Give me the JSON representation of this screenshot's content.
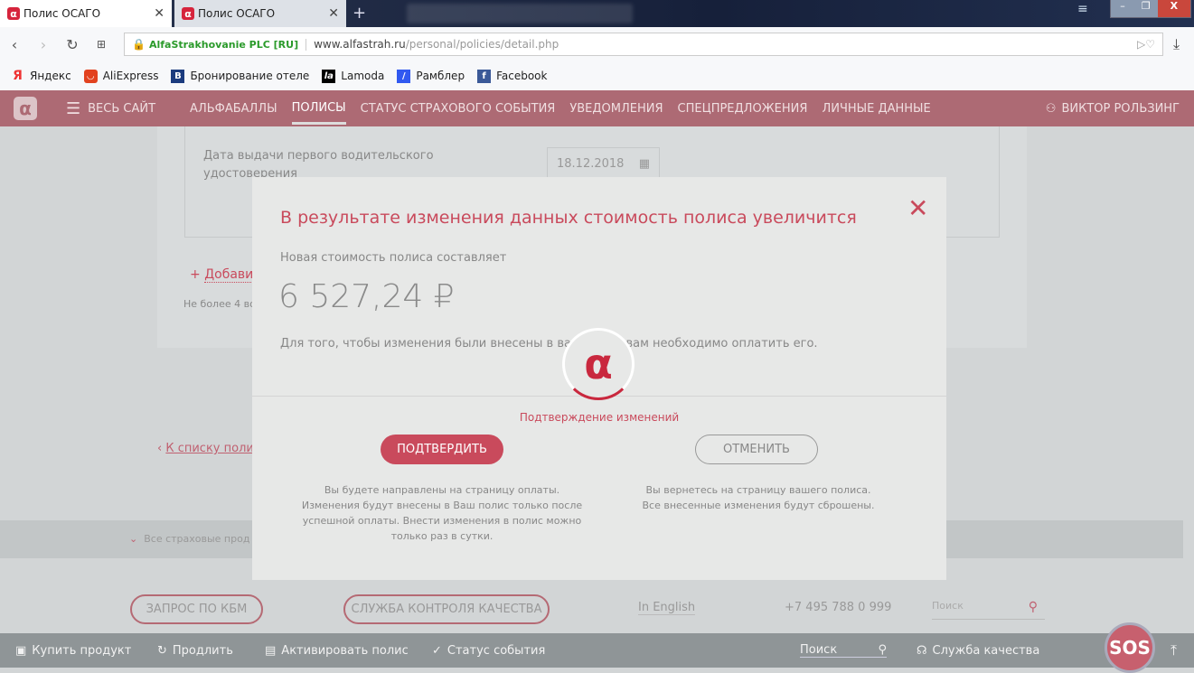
{
  "browser": {
    "tabs": [
      {
        "title": "Полис ОСАГО",
        "active": true
      },
      {
        "title": "Полис ОСАГО",
        "active": false
      }
    ],
    "address": {
      "security_label": "AlfaStrakhovanie PLC [RU]",
      "url_domain": "www.alfastrah.ru",
      "url_path": "/personal/policies/detail.php"
    },
    "bookmarks": [
      {
        "label": "Яндекс",
        "icon": "yandex-icon",
        "color": "#e33"
      },
      {
        "label": "AliExpress",
        "icon": "aliexpress-icon",
        "color": "#e2421f"
      },
      {
        "label": "Бронирование отеле",
        "icon": "booking-icon",
        "color": "#1b3b7e"
      },
      {
        "label": "Lamoda",
        "icon": "lamoda-icon",
        "color": "#000"
      },
      {
        "label": "Рамблер",
        "icon": "rambler-icon",
        "color": "#3159f0"
      },
      {
        "label": "Facebook",
        "icon": "facebook-icon",
        "color": "#3b5998"
      }
    ]
  },
  "site_nav": {
    "all_site": "ВЕСЬ САЙТ",
    "items": [
      "АЛЬФАБАЛЛЫ",
      "ПОЛИСЫ",
      "СТАТУС СТРАХОВОГО СОБЫТИЯ",
      "УВЕДОМЛЕНИЯ",
      "СПЕЦПРЕДЛОЖЕНИЯ",
      "ЛИЧНЫЕ ДАННЫЕ"
    ],
    "active": "ПОЛИСЫ",
    "user": "ВИКТОР РОЛЬЗИНГ",
    "brand_color": "#ad6a74"
  },
  "background_page": {
    "license_date_label": "Дата выдачи первого водительского удостоверения",
    "license_date_value": "18.12.2018",
    "add_link": "Добави",
    "limit_note": "Не более 4 во",
    "back_link": "К списку поли",
    "all_products": "Все страховые прод"
  },
  "modal": {
    "title": "В результате изменения данных стоимость полиса увеличится",
    "subtitle": "Новая стоимость полиса составляет",
    "price": "6 527,24 ₽",
    "note": "Для того, чтобы изменения были внесены в ваш полис вам необходимо оплатить его.",
    "loading_label": "Подтверждение изменений",
    "confirm_button": "ПОДТВЕРДИТЬ",
    "cancel_button": "ОТМЕНИТЬ",
    "confirm_hint": [
      "Вы будете направлены на страницу оплаты.",
      "Изменения будут внесены в Ваш полис только после",
      "успешной оплаты. Внести изменения в полис можно",
      "только раз в сутки."
    ],
    "cancel_hint": [
      "Вы вернетесь на страницу вашего полиса.",
      "Все внесенные изменения будут сброшены."
    ],
    "accent_color": "#c94a5c"
  },
  "footer": {
    "kbm_button": "ЗАПРОС ПО КБМ",
    "quality_button": "СЛУЖБА КОНТРОЛЯ КАЧЕСТВА",
    "english_link": "In English",
    "phone": "+7 495 788 0 999",
    "search_placeholder": "Поиск"
  },
  "bottom_bar": {
    "buy": "Купить продукт",
    "renew": "Продлить",
    "activate": "Активировать полис",
    "status": "Статус события",
    "search_placeholder": "Поиск",
    "quality": "Служба качества",
    "sos": "SOS"
  }
}
